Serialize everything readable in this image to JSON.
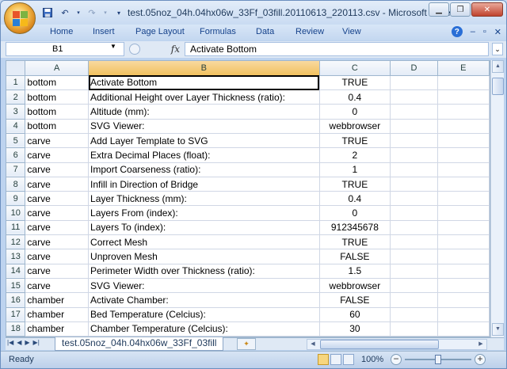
{
  "window": {
    "title": "test.05noz_04h.04hx06w_33Ff_03fill.20110613_220113.csv - Microsoft Excel"
  },
  "ribbon": {
    "tabs": [
      "Home",
      "Insert",
      "Page Layout",
      "Formulas",
      "Data",
      "Review",
      "View"
    ]
  },
  "formula_bar": {
    "name_box": "B1",
    "fx_label": "fx",
    "content": "Activate Bottom"
  },
  "columns": [
    "A",
    "B",
    "C",
    "D",
    "E"
  ],
  "rows": [
    {
      "n": "1",
      "a": "bottom",
      "b": "Activate Bottom",
      "c": "TRUE"
    },
    {
      "n": "2",
      "a": "bottom",
      "b": "Additional Height over Layer Thickness (ratio):",
      "c": "0.4"
    },
    {
      "n": "3",
      "a": "bottom",
      "b": "Altitude (mm):",
      "c": "0"
    },
    {
      "n": "4",
      "a": "bottom",
      "b": "SVG Viewer:",
      "c": "webbrowser"
    },
    {
      "n": "5",
      "a": "carve",
      "b": "Add Layer Template to SVG",
      "c": "TRUE"
    },
    {
      "n": "6",
      "a": "carve",
      "b": "Extra Decimal Places (float):",
      "c": "2"
    },
    {
      "n": "7",
      "a": "carve",
      "b": "Import Coarseness (ratio):",
      "c": "1"
    },
    {
      "n": "8",
      "a": "carve",
      "b": "Infill in Direction of Bridge",
      "c": "TRUE"
    },
    {
      "n": "9",
      "a": "carve",
      "b": "Layer Thickness (mm):",
      "c": "0.4"
    },
    {
      "n": "10",
      "a": "carve",
      "b": "Layers From (index):",
      "c": "0"
    },
    {
      "n": "11",
      "a": "carve",
      "b": "Layers To (index):",
      "c": "912345678"
    },
    {
      "n": "12",
      "a": "carve",
      "b": "Correct Mesh",
      "c": "TRUE"
    },
    {
      "n": "13",
      "a": "carve",
      "b": "Unproven Mesh",
      "c": "FALSE"
    },
    {
      "n": "14",
      "a": "carve",
      "b": "Perimeter Width over Thickness (ratio):",
      "c": "1.5"
    },
    {
      "n": "15",
      "a": "carve",
      "b": "SVG Viewer:",
      "c": "webbrowser"
    },
    {
      "n": "16",
      "a": "chamber",
      "b": "Activate Chamber:",
      "c": "FALSE"
    },
    {
      "n": "17",
      "a": "chamber",
      "b": "Bed Temperature (Celcius):",
      "c": "60"
    },
    {
      "n": "18",
      "a": "chamber",
      "b": "Chamber Temperature (Celcius):",
      "c": "30"
    }
  ],
  "sheet_tab": "test.05noz_04h.04hx06w_33Ff_03fill",
  "status": {
    "text": "Ready",
    "zoom": "100%"
  },
  "colors": {
    "selected_header": "#f1c15f",
    "window_frame": "#bdd3ef"
  }
}
